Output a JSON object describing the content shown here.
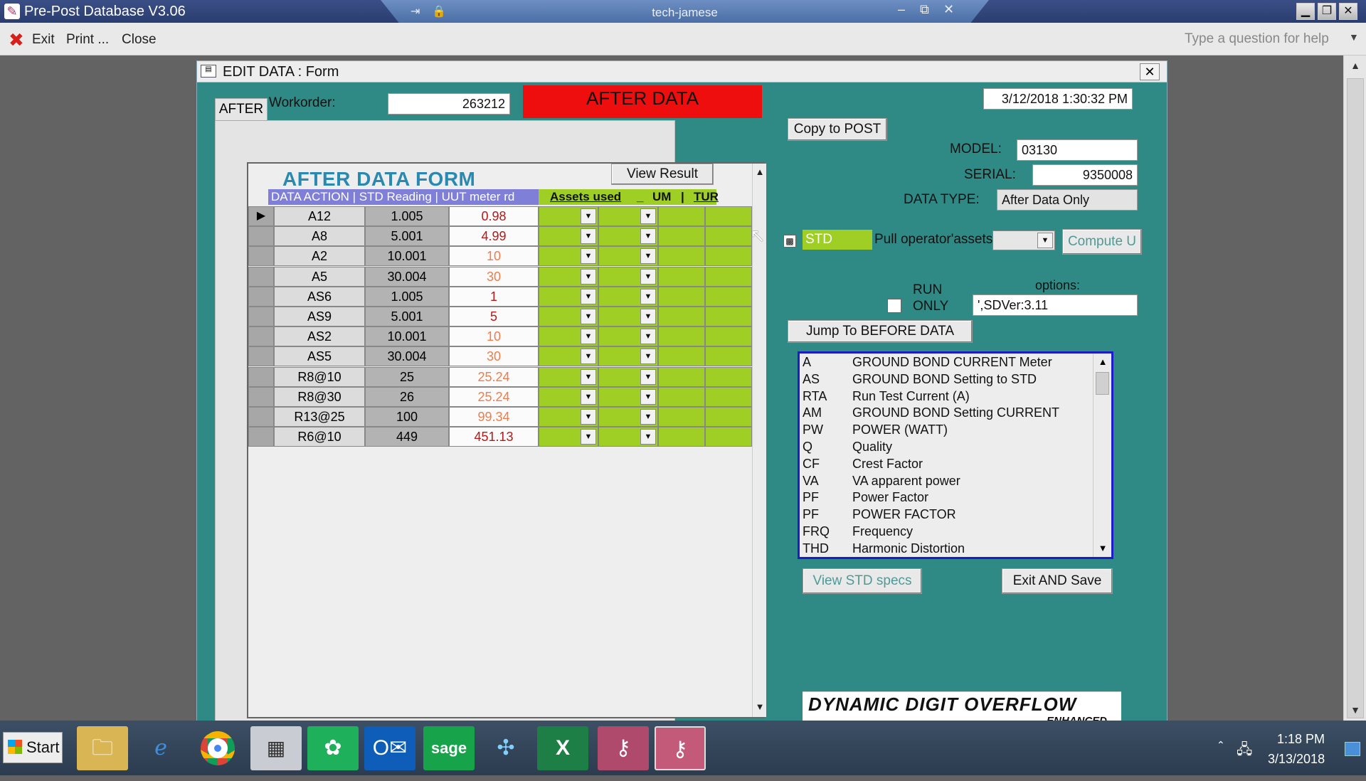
{
  "window": {
    "app_title": "Pre-Post Database V3.06",
    "remote_session": "tech-jamese",
    "controls": {
      "minimize": "▁",
      "restore": "❐",
      "close": "✕"
    }
  },
  "menu": {
    "exit": "Exit",
    "print": "Print ...",
    "close": "Close",
    "help_placeholder": "Type a question for help"
  },
  "form": {
    "title": "EDIT DATA : Form",
    "workorder_label": "Workorder:",
    "workorder_value": "263212",
    "banner": "AFTER DATA",
    "timestamp": "3/12/2018 1:30:32 PM",
    "tab_label": "AFTER",
    "copy_to_post": "Copy to POST",
    "model_label": "MODEL:",
    "model_value": "03130",
    "serial_label": "SERIAL:",
    "serial_value": "9350008",
    "data_type_label": "DATA TYPE:",
    "data_type_value": "After Data Only",
    "std_label": "STD",
    "pull_label": "Pull operator'assets",
    "compute_button": "Compute U",
    "run_label_1": "RUN",
    "run_label_2": "ONLY",
    "options_label": "options:",
    "options_value": "',SDVer:3.11",
    "jump_button": "Jump To BEFORE DATA",
    "view_std_button": "View STD specs",
    "exit_save_button": "Exit AND Save",
    "ddo_title": "DYNAMIC DIGIT OVERFLOW",
    "ddo_sub": "ENHANCED"
  },
  "subform": {
    "title": "AFTER DATA FORM",
    "view_result": "View Result",
    "header_left": "DATA ACTION | STD Reading | UUT meter rd",
    "col_assets": "Assets used",
    "col_sep": "_",
    "col_um": "UM",
    "col_bar": "|",
    "col_tur": "TUR",
    "rows": [
      {
        "action": "A12",
        "std": "1.005",
        "uut": "0.98",
        "tone": "red"
      },
      {
        "action": "A8",
        "std": "5.001",
        "uut": "4.99",
        "tone": "red"
      },
      {
        "action": "A2",
        "std": "10.001",
        "uut": "10",
        "tone": "orange"
      },
      {
        "action": "A5",
        "std": "30.004",
        "uut": "30",
        "tone": "orange"
      },
      {
        "action": "AS6",
        "std": "1.005",
        "uut": "1",
        "tone": "red"
      },
      {
        "action": "AS9",
        "std": "5.001",
        "uut": "5",
        "tone": "red"
      },
      {
        "action": "AS2",
        "std": "10.001",
        "uut": "10",
        "tone": "orange"
      },
      {
        "action": "AS5",
        "std": "30.004",
        "uut": "30",
        "tone": "orange"
      },
      {
        "action": "R8@10",
        "std": "25",
        "uut": "25.24",
        "tone": "orange"
      },
      {
        "action": "R8@30",
        "std": "26",
        "uut": "25.24",
        "tone": "orange"
      },
      {
        "action": "R13@25",
        "std": "100",
        "uut": "99.34",
        "tone": "orange"
      },
      {
        "action": "R6@10",
        "std": "449",
        "uut": "451.13",
        "tone": "red"
      }
    ]
  },
  "codes": [
    {
      "code": "A",
      "desc": "GROUND BOND CURRENT Meter"
    },
    {
      "code": "AS",
      "desc": "GROUND BOND Setting to STD"
    },
    {
      "code": "RTA",
      "desc": "Run Test Current (A)"
    },
    {
      "code": "AM",
      "desc": "GROUND BOND Setting CURRENT"
    },
    {
      "code": "PW",
      "desc": "POWER (WATT)"
    },
    {
      "code": "Q",
      "desc": "Quality"
    },
    {
      "code": "CF",
      "desc": "Crest Factor"
    },
    {
      "code": "VA",
      "desc": "VA apparent power"
    },
    {
      "code": "PF",
      "desc": "Power Factor"
    },
    {
      "code": "PF",
      "desc": "POWER FACTOR"
    },
    {
      "code": "FRQ",
      "desc": "Frequency"
    },
    {
      "code": "THD",
      "desc": "Harmonic Distortion"
    }
  ],
  "taskbar": {
    "start": "Start",
    "sage_label": "sage",
    "time": "1:18 PM",
    "date": "3/13/2018"
  },
  "colors": {
    "banner_red": "#ef0e0e",
    "form_teal": "#2f8a86",
    "grid_green": "#9fce25",
    "header_blue": "#7f7fd8",
    "title_blue": "#2a89b0",
    "list_border": "#1c1cc8"
  }
}
